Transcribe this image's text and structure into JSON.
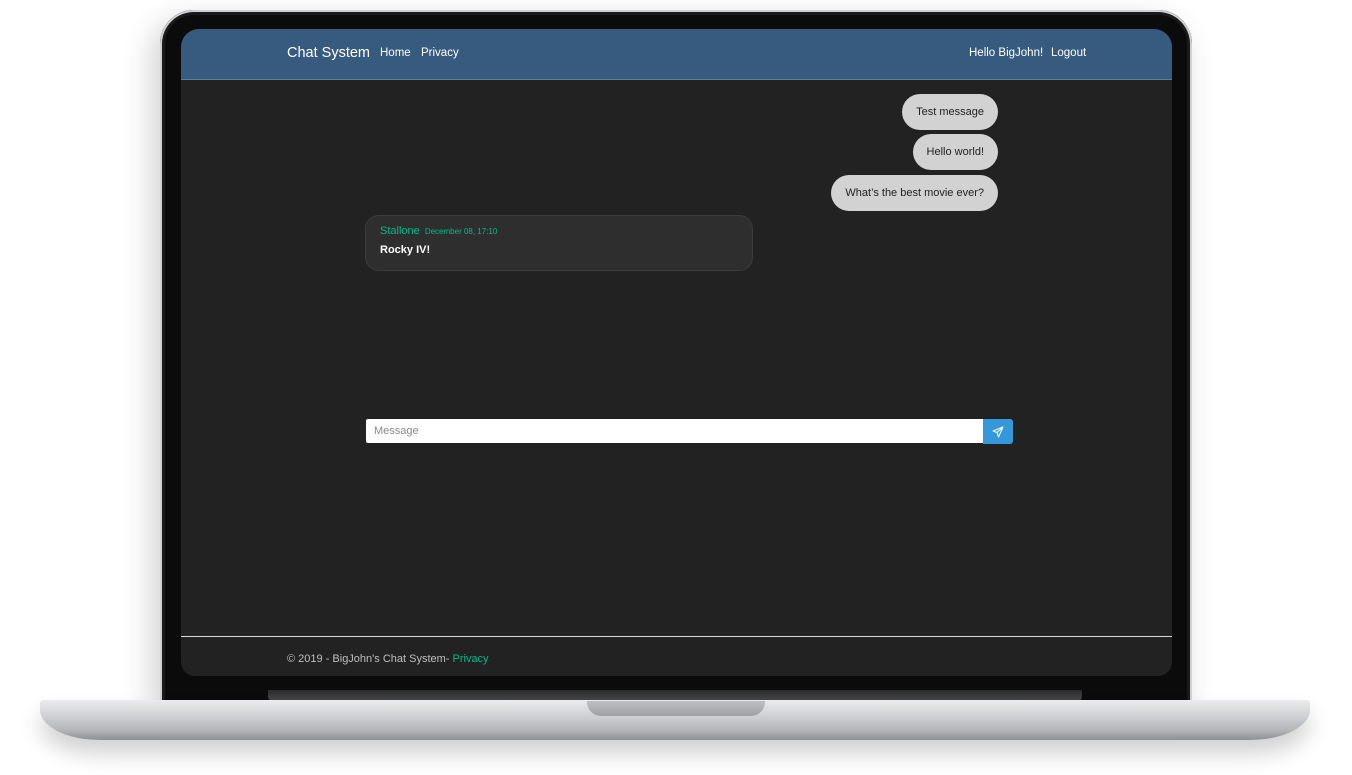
{
  "navbar": {
    "brand": "Chat System",
    "links": [
      "Home",
      "Privacy"
    ],
    "greeting": "Hello BigJohn!",
    "logout": "Logout"
  },
  "messages": {
    "outgoing": [
      "Test message",
      "Hello world!",
      "What’s the best movie ever?"
    ],
    "incoming": {
      "sender": "Stallone",
      "timestamp": "December 08, 17:10",
      "text": "Rocky IV!"
    }
  },
  "composer": {
    "placeholder": "Message",
    "send_icon": "paper-plane-icon"
  },
  "footer": {
    "copyright": "© 2019 - BigJohn's Chat System- ",
    "privacy_link": "Privacy"
  },
  "colors": {
    "navbar": "#375a7f",
    "screen_bg": "#222222",
    "accent": "#00bc8c",
    "send_button": "#3498db",
    "outgoing_bubble": "#d2d2d2"
  }
}
